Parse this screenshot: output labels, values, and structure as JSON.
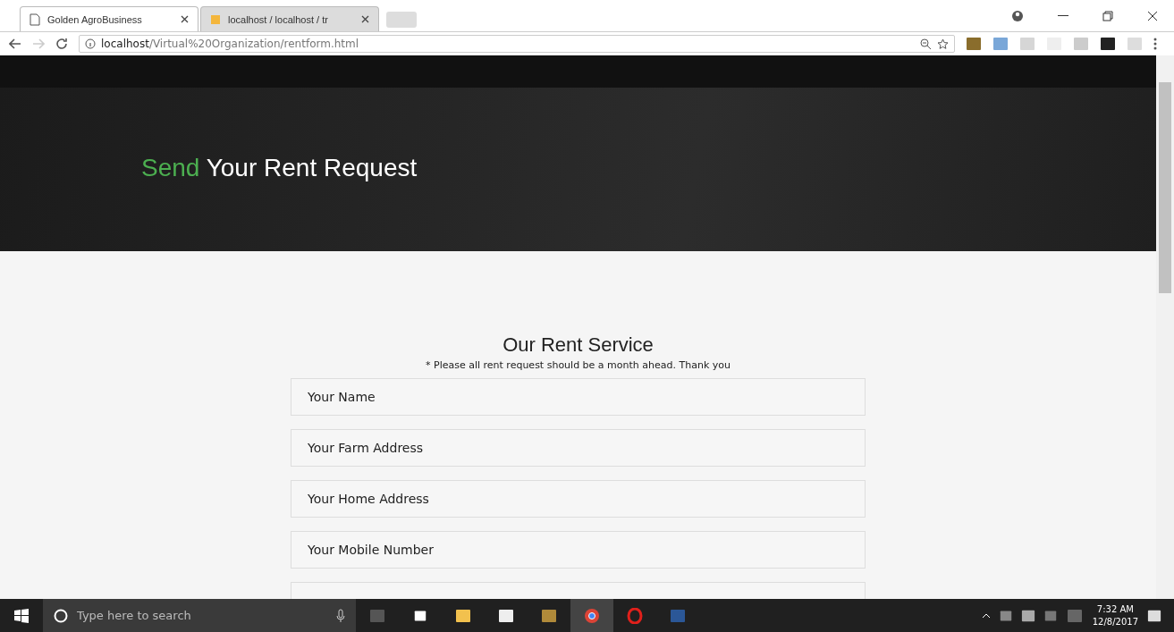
{
  "browser": {
    "tabs": [
      {
        "title": "Golden AgroBusiness",
        "selected": true
      },
      {
        "title": "localhost / localhost / tr",
        "selected": false
      }
    ],
    "address": {
      "host": "localhost",
      "path": "/Virtual%20Organization/rentform.html"
    }
  },
  "hero": {
    "accent": "Send",
    "title": " Your Rent Request"
  },
  "form": {
    "title": "Our Rent Service",
    "note": "* Please all rent request should be a month ahead. Thank you",
    "fields": [
      {
        "placeholder": "Your Name"
      },
      {
        "placeholder": "Your Farm Address"
      },
      {
        "placeholder": "Your Home Address"
      },
      {
        "placeholder": "Your Mobile Number"
      }
    ]
  },
  "taskbar": {
    "search_placeholder": "Type here to search",
    "time": "7:32 AM",
    "date": "12/8/2017"
  }
}
